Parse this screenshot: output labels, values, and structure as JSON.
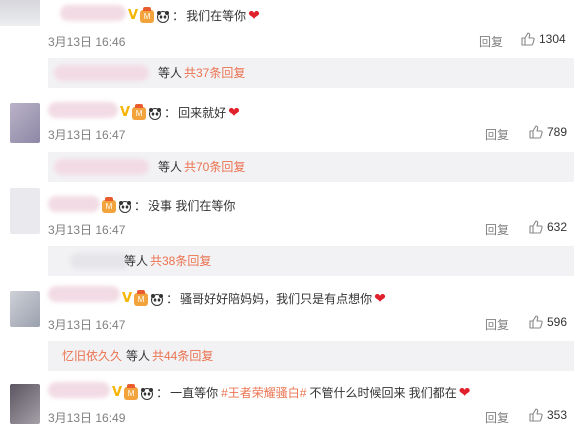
{
  "comments": [
    {
      "text": "我们在等你",
      "has_heart": true,
      "date": "3月13日",
      "time": "16:46",
      "reply_label": "回复",
      "likes": "1304",
      "sub": {
        "prefix": "等人",
        "link": "共37条回复"
      }
    },
    {
      "text": "回来就好",
      "has_heart": true,
      "date": "3月13日",
      "time": "16:47",
      "reply_label": "回复",
      "likes": "789",
      "sub": {
        "prefix": "等人",
        "link": "共70条回复"
      }
    },
    {
      "text": "没事 我们在等你",
      "has_heart": false,
      "date": "3月13日",
      "time": "16:47",
      "reply_label": "回复",
      "likes": "632",
      "sub": {
        "prefix": "等人",
        "link": "共38条回复"
      }
    },
    {
      "text": "骚哥好好陪妈妈，我们只是有点想你",
      "has_heart": true,
      "date": "3月13日",
      "time": "16:47",
      "reply_label": "回复",
      "likes": "596",
      "sub": {
        "name": "忆旧依久久",
        "prefix": "等人",
        "link": "共44条回复"
      }
    },
    {
      "text_before": "一直等你",
      "topic": "#王者荣耀骚白#",
      "text_after": "不管什么时候回来 我们都在",
      "has_heart": true,
      "date": "3月13日",
      "time": "16:49",
      "reply_label": "回复",
      "likes": "353"
    }
  ],
  "icons": {
    "verified": "V",
    "colon": "：",
    "heart": "❤",
    "like": "thumbs-up-icon",
    "level": "level-badge-icon",
    "panda": "panda-icon"
  },
  "colors": {
    "link_orange": "#eb7350",
    "meta_grey": "#808080",
    "sub_bg": "#f2f2f5",
    "heart_red": "#e0202a",
    "verified_gold": "#f4b400"
  }
}
